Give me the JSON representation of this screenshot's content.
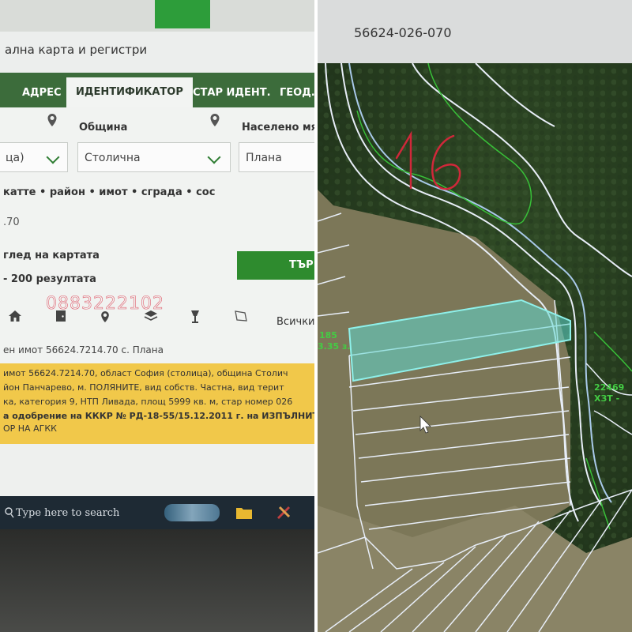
{
  "left": {
    "window_title": "ална карта и регистри",
    "tabs": [
      "АДРЕС",
      "ИДЕНТИФИКАТОР",
      "СТАР ИДЕНТ.",
      "ГЕОД."
    ],
    "form": {
      "municipality_label": "Община",
      "settlement_label": "Населено мя",
      "region_value": "ца)",
      "municipality_value": "Столична",
      "settlement_value": "Плана",
      "identifier_hint": "катте • район • имот • сграда • сос",
      "identifier_value": ".70",
      "map_view_label": "глед на картата",
      "search_button": "ТЪР",
      "results_text": "- 200 резултата"
    },
    "phone_overlay": "0883222102",
    "icons": [
      "home-icon",
      "door-icon",
      "map-pin-icon",
      "layers-icon",
      "lamp-icon",
      "polygon-icon"
    ],
    "filter_label": "Всички",
    "result_title": "ен имот 56624.7214.70 с. Плана",
    "info_lines": [
      "имот 56624.7214.70, област София (столица), община Столич",
      "йон Панчарево, м. ПОЛЯНИТЕ, вид собств. Частна, вид терит",
      "ка, категория 9, НТП Ливада, площ 5999 кв. м, стар номер 026",
      "а одобрение на КККР № РД-18-55/15.12.2011 г. на ИЗПЪЛНИТ",
      "ОР НА АГКК"
    ],
    "taskbar_search": "Type here to search",
    "colors": {
      "tab_bar": "#3c6c3b",
      "accent": "#2e8b2e",
      "info_bg": "#f1c84a"
    }
  },
  "right": {
    "parcel_id": "56624-026-070",
    "handwritten_number": "16",
    "map_labels": {
      "left_a": "185",
      "left_b": "3.35 з.",
      "right_a": "22469",
      "right_b": "ХЗТ -"
    },
    "colors": {
      "highlight": "#5fd8d0",
      "boundary": "#e8f0ff",
      "annotation": "#d0283a",
      "green_line": "#38c038"
    }
  }
}
